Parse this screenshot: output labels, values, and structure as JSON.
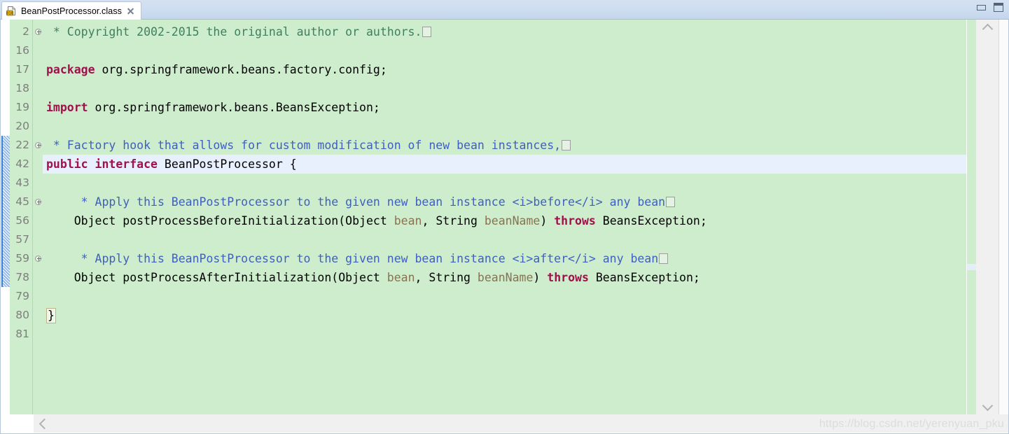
{
  "window": {
    "minimize_label": "Minimize",
    "maximize_label": "Maximize"
  },
  "tab": {
    "label": "BeanPostProcessor.class",
    "icon": "class-file-icon",
    "close_icon": "close-icon"
  },
  "editor": {
    "language": "java",
    "current_line": 42,
    "change_bar": {
      "start_line_index": 6,
      "end_line_index": 13
    },
    "colors": {
      "background": "#cdedcd",
      "gutter": "#cdedcd",
      "current_line": "#e8f0fd",
      "keyword": "#a0104a",
      "comment": "#3f7f5f",
      "javadoc": "#3f5fbf",
      "parameter": "#8a7250",
      "line_number": "#7d7d7d",
      "change_marker": "#3c7fd0"
    },
    "lines": [
      {
        "number": "2",
        "fold": "collapsed",
        "segments": [
          {
            "style": "cmt",
            "text": " * Copyright 2002-2015 the original author or authors."
          },
          {
            "style": "foldbox",
            "text": ""
          }
        ]
      },
      {
        "number": "16",
        "fold": "none",
        "segments": []
      },
      {
        "number": "17",
        "fold": "none",
        "segments": [
          {
            "style": "kw",
            "text": "package"
          },
          {
            "style": "plain",
            "text": " org.springframework.beans.factory.config;"
          }
        ]
      },
      {
        "number": "18",
        "fold": "none",
        "segments": []
      },
      {
        "number": "19",
        "fold": "none",
        "segments": [
          {
            "style": "kw",
            "text": "import"
          },
          {
            "style": "plain",
            "text": " org.springframework.beans.BeansException;"
          }
        ]
      },
      {
        "number": "20",
        "fold": "none",
        "segments": []
      },
      {
        "number": "22",
        "fold": "collapsed",
        "segments": [
          {
            "style": "doc",
            "text": " * Factory hook that allows for custom modification of new bean instances,"
          },
          {
            "style": "foldbox",
            "text": ""
          }
        ]
      },
      {
        "number": "42",
        "fold": "none",
        "current": true,
        "segments": [
          {
            "style": "kw",
            "text": "public interface"
          },
          {
            "style": "plain",
            "text": " BeanPostProcessor {"
          }
        ]
      },
      {
        "number": "43",
        "fold": "none",
        "segments": []
      },
      {
        "number": "45",
        "fold": "collapsed",
        "segments": [
          {
            "style": "doc",
            "text": "     * Apply this BeanPostProcessor to the given new bean instance <i>before</i> any bean"
          },
          {
            "style": "foldbox",
            "text": ""
          }
        ]
      },
      {
        "number": "56",
        "fold": "none",
        "segments": [
          {
            "style": "plain",
            "text": "    Object postProcessBeforeInitialization(Object "
          },
          {
            "style": "param",
            "text": "bean"
          },
          {
            "style": "plain",
            "text": ", String "
          },
          {
            "style": "param",
            "text": "beanName"
          },
          {
            "style": "plain",
            "text": ") "
          },
          {
            "style": "kw",
            "text": "throws"
          },
          {
            "style": "plain",
            "text": " BeansException;"
          }
        ]
      },
      {
        "number": "57",
        "fold": "none",
        "segments": []
      },
      {
        "number": "59",
        "fold": "collapsed",
        "segments": [
          {
            "style": "doc",
            "text": "     * Apply this BeanPostProcessor to the given new bean instance <i>after</i> any bean"
          },
          {
            "style": "foldbox",
            "text": ""
          }
        ]
      },
      {
        "number": "78",
        "fold": "none",
        "segments": [
          {
            "style": "plain",
            "text": "    Object postProcessAfterInitialization(Object "
          },
          {
            "style": "param",
            "text": "bean"
          },
          {
            "style": "plain",
            "text": ", String "
          },
          {
            "style": "param",
            "text": "beanName"
          },
          {
            "style": "plain",
            "text": ") "
          },
          {
            "style": "kw",
            "text": "throws"
          },
          {
            "style": "plain",
            "text": " BeansException;"
          }
        ]
      },
      {
        "number": "79",
        "fold": "none",
        "segments": []
      },
      {
        "number": "80",
        "fold": "none",
        "segments": [
          {
            "style": "brace",
            "text": "}"
          }
        ]
      },
      {
        "number": "81",
        "fold": "none",
        "segments": []
      }
    ]
  },
  "scrollbars": {
    "vertical_up_icon": "chevron-up-icon",
    "vertical_down_icon": "chevron-down-icon",
    "horizontal_left_icon": "chevron-left-icon"
  },
  "watermark": {
    "text": "https://blog.csdn.net/yerenyuan_pku"
  }
}
